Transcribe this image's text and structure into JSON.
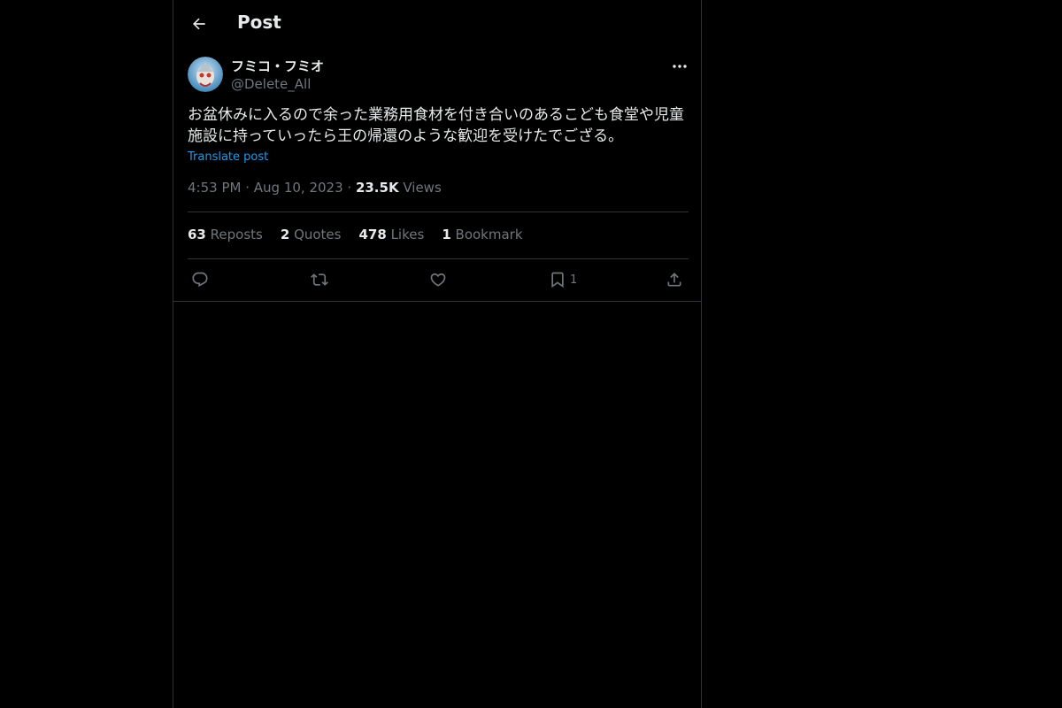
{
  "header": {
    "title": "Post",
    "back_icon": "arrow-left-icon"
  },
  "author": {
    "display_name": "フミコ・フミオ",
    "handle": "@Delete_All",
    "avatar_icon": "avatar-image"
  },
  "post": {
    "text": "お盆休みに入るので余った業務用食材を付き合いのあるこども食堂や児童施設に持っていったら王の帰還のような歓迎を受けたでござる。",
    "translate_label": "Translate post",
    "time": "4:53 PM",
    "date": "Aug 10, 2023",
    "views_count": "23.5K",
    "views_label": "Views"
  },
  "stats": {
    "reposts": {
      "num": "63",
      "label": "Reposts"
    },
    "quotes": {
      "num": "2",
      "label": "Quotes"
    },
    "likes": {
      "num": "478",
      "label": "Likes"
    },
    "bookmarks": {
      "num": "1",
      "label": "Bookmark"
    }
  },
  "actions": {
    "reply_icon": "reply-icon",
    "repost_icon": "repost-icon",
    "like_icon": "heart-icon",
    "bookmark_icon": "bookmark-icon",
    "bookmark_count": "1",
    "share_icon": "share-icon"
  },
  "colors": {
    "background": "#000000",
    "text": "#e7e9ea",
    "muted": "#71767b",
    "accent": "#1d9bf0",
    "border": "#2f3336"
  }
}
